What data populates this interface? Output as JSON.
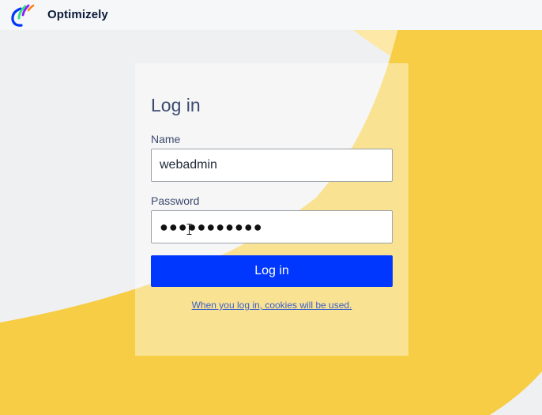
{
  "app": {
    "brand_name": "Optimizely",
    "logo_icon": "optimizely-logo-icon"
  },
  "login": {
    "title": "Log in",
    "name_label": "Name",
    "name_value": "webadmin",
    "password_label": "Password",
    "password_value": "●●●●●●●●●●●",
    "button_label": "Log in",
    "cookie_notice": "When you log in, cookies will be used."
  },
  "colors": {
    "accent": "#0037ff",
    "background": "#eff0f2",
    "brand_yellow": "#f7cd45",
    "brand_yellow_light": "#fae29a"
  }
}
